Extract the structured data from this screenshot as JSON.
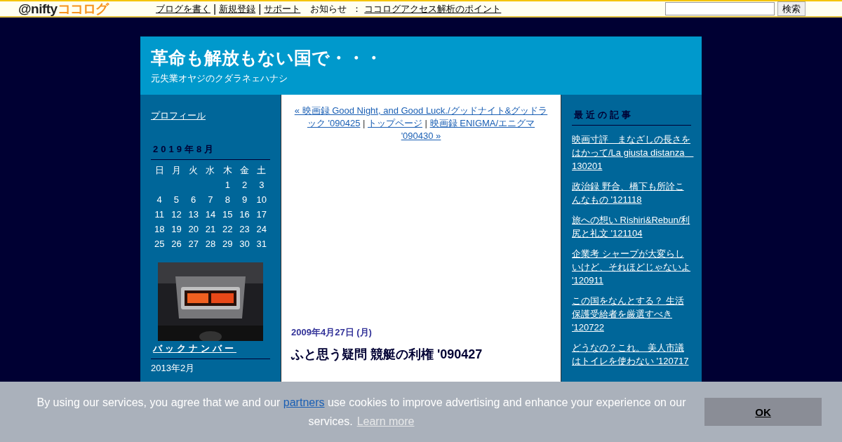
{
  "topbar": {
    "logo_at": "@nifty",
    "logo_main": "ココログ",
    "links": [
      {
        "label": "ブログを書く"
      },
      {
        "label": "新規登録",
        "separator": "|"
      },
      {
        "label": "サポート",
        "separator": "|"
      }
    ],
    "notice_label": "お知らせ",
    "notice_sep": "：",
    "notice_link": "ココログアクセス解析のポイント",
    "search_button": "検索"
  },
  "blog": {
    "title": "革命も解放もない国で・・・",
    "subtitle": "元失業オヤジのクダラネェハナシ"
  },
  "left": {
    "profile": "プロフィール",
    "calendar": {
      "title": "2019年8月",
      "weekdays": [
        "日",
        "月",
        "火",
        "水",
        "木",
        "金",
        "土"
      ],
      "weeks": [
        {
          "kind": "partial",
          "days": [
            "1",
            "2",
            "3"
          ]
        },
        {
          "kind": "full",
          "days": [
            "4",
            "5",
            "6",
            "7",
            "8",
            "9",
            "10"
          ]
        },
        {
          "kind": "full",
          "days": [
            "11",
            "12",
            "13",
            "14",
            "15",
            "16",
            "17"
          ]
        },
        {
          "kind": "full",
          "days": [
            "18",
            "19",
            "20",
            "21",
            "22",
            "23",
            "24"
          ]
        },
        {
          "kind": "full",
          "days": [
            "25",
            "26",
            "27",
            "28",
            "29",
            "30",
            "31"
          ]
        }
      ]
    },
    "backnumber_title": "バックナンバー",
    "backnumbers": [
      "2013年2月"
    ]
  },
  "center": {
    "nav": [
      {
        "kind": "link",
        "text": "« 映画録 Good Night, and Good Luck./グッドナイト&グッドラック '090425"
      },
      {
        "kind": "sep",
        "text": " | "
      },
      {
        "kind": "link",
        "text": "トップページ"
      },
      {
        "kind": "sep",
        "text": " | "
      },
      {
        "kind": "link",
        "text": "映画録 ENIGMA/エニグマ '090430 »"
      }
    ],
    "date": "2009年4月27日 (月)",
    "post_title": "ふと思う疑問 競艇の利権 '090427"
  },
  "right": {
    "title": "最近の記事",
    "posts": [
      "映画寸評　まなざしの長さをはかって/La giusta distanza　130201",
      "政治録 野合、橋下も所詮こんなもの '121118",
      "旅への想い Rishiri&Rebun/利尻と礼文 '121104",
      "企業考 シャープが大変らしいけど、それほどじゃないよ '120911",
      "この国をなんとする？ 生活保護受給者を厳選すべき '120722",
      "どうなの？これ。 美人市議はトイレを使わない '120717"
    ]
  },
  "cookie": {
    "before": "By using our services, you agree that we and our ",
    "link": "partners",
    "after": " use cookies to improve advertising and enhance your experience on our services.",
    "learn_more": "Learn more",
    "ok": "OK"
  }
}
